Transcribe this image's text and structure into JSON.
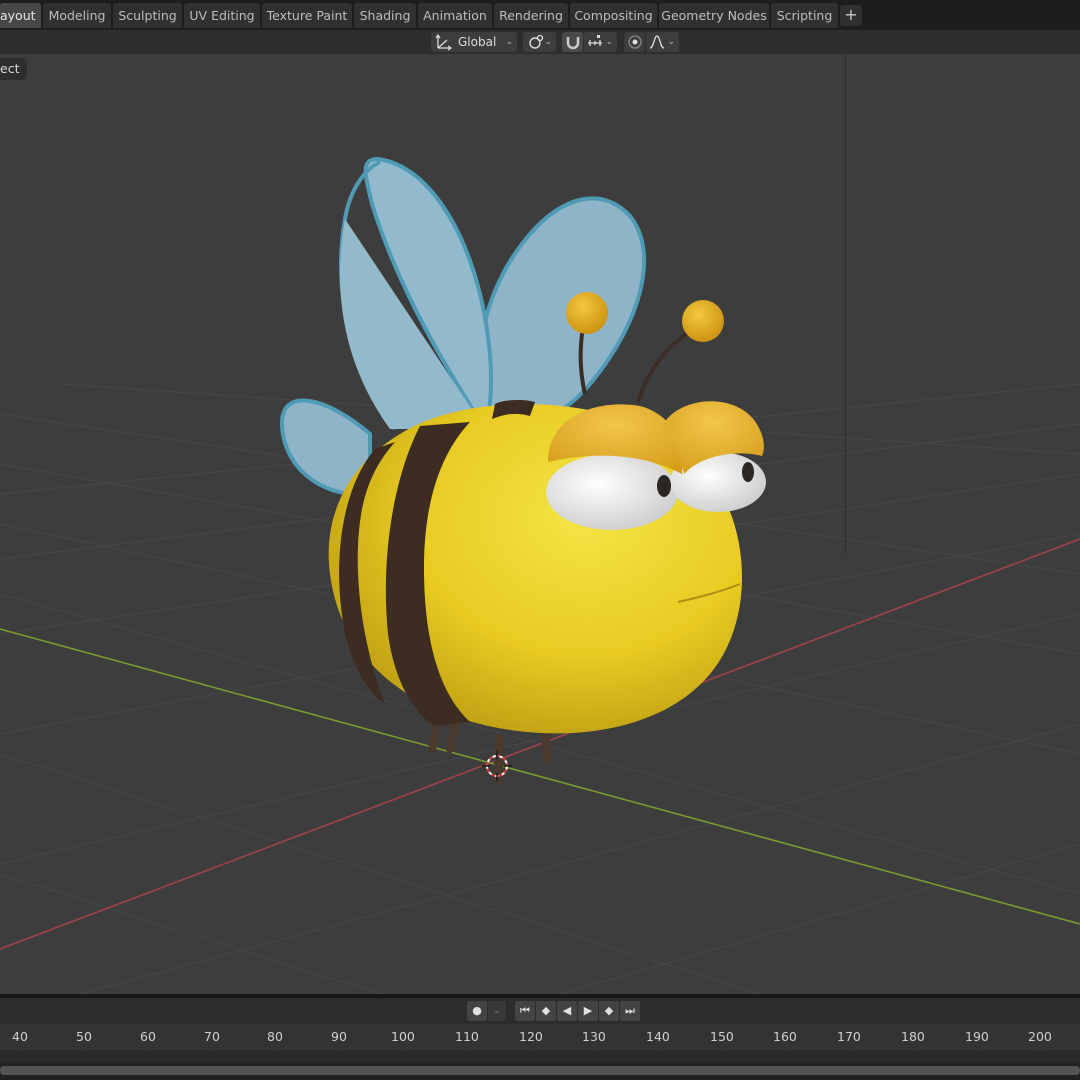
{
  "workspace_tabs": [
    {
      "label": "ayout",
      "active": true
    },
    {
      "label": "Modeling"
    },
    {
      "label": "Sculpting"
    },
    {
      "label": "UV Editing"
    },
    {
      "label": "Texture Paint"
    },
    {
      "label": "Shading"
    },
    {
      "label": "Animation"
    },
    {
      "label": "Rendering"
    },
    {
      "label": "Compositing"
    },
    {
      "label": "Geometry Nodes"
    },
    {
      "label": "Scripting"
    }
  ],
  "add_tab_label": "+",
  "header": {
    "orientation_value": "Global",
    "orientation_icon": "transform-orientation-icon",
    "pivot_icon": "pivot-point-icon",
    "snap_icon": "magnet-snap-icon",
    "snap_target_icon": "snap-increment-icon",
    "proportional_icon": "proportional-edit-icon",
    "falloff_icon": "falloff-curve-icon"
  },
  "viewport": {
    "mode_label": "ect",
    "background_color": "#3d3d3d",
    "x_axis_color": "#a0424a",
    "y_axis_color": "#7a9a2e"
  },
  "timeline": {
    "controls": [
      "record-icon",
      "jump-start-icon",
      "prev-keyframe-icon",
      "play-reverse-icon",
      "play-icon",
      "next-keyframe-icon",
      "jump-end-icon"
    ],
    "frame_ticks": [
      "40",
      "50",
      "60",
      "70",
      "80",
      "90",
      "100",
      "110",
      "120",
      "130",
      "140",
      "150",
      "160",
      "170",
      "180",
      "190",
      "200"
    ]
  }
}
